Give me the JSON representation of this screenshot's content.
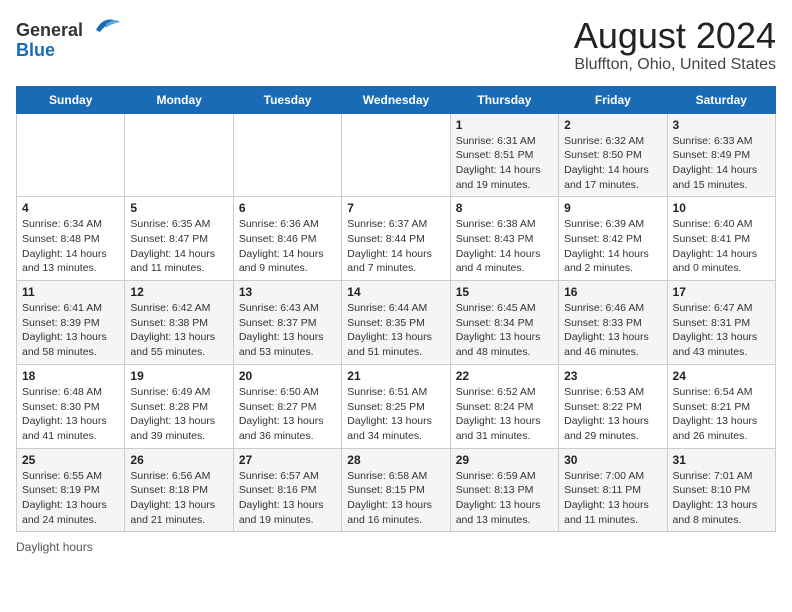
{
  "header": {
    "logo_general": "General",
    "logo_blue": "Blue",
    "title": "August 2024",
    "subtitle": "Bluffton, Ohio, United States"
  },
  "weekdays": [
    "Sunday",
    "Monday",
    "Tuesday",
    "Wednesday",
    "Thursday",
    "Friday",
    "Saturday"
  ],
  "weeks": [
    [
      {
        "day": "",
        "sunrise": "",
        "sunset": "",
        "daylight": ""
      },
      {
        "day": "",
        "sunrise": "",
        "sunset": "",
        "daylight": ""
      },
      {
        "day": "",
        "sunrise": "",
        "sunset": "",
        "daylight": ""
      },
      {
        "day": "",
        "sunrise": "",
        "sunset": "",
        "daylight": ""
      },
      {
        "day": "1",
        "sunrise": "Sunrise: 6:31 AM",
        "sunset": "Sunset: 8:51 PM",
        "daylight": "Daylight: 14 hours and 19 minutes."
      },
      {
        "day": "2",
        "sunrise": "Sunrise: 6:32 AM",
        "sunset": "Sunset: 8:50 PM",
        "daylight": "Daylight: 14 hours and 17 minutes."
      },
      {
        "day": "3",
        "sunrise": "Sunrise: 6:33 AM",
        "sunset": "Sunset: 8:49 PM",
        "daylight": "Daylight: 14 hours and 15 minutes."
      }
    ],
    [
      {
        "day": "4",
        "sunrise": "Sunrise: 6:34 AM",
        "sunset": "Sunset: 8:48 PM",
        "daylight": "Daylight: 14 hours and 13 minutes."
      },
      {
        "day": "5",
        "sunrise": "Sunrise: 6:35 AM",
        "sunset": "Sunset: 8:47 PM",
        "daylight": "Daylight: 14 hours and 11 minutes."
      },
      {
        "day": "6",
        "sunrise": "Sunrise: 6:36 AM",
        "sunset": "Sunset: 8:46 PM",
        "daylight": "Daylight: 14 hours and 9 minutes."
      },
      {
        "day": "7",
        "sunrise": "Sunrise: 6:37 AM",
        "sunset": "Sunset: 8:44 PM",
        "daylight": "Daylight: 14 hours and 7 minutes."
      },
      {
        "day": "8",
        "sunrise": "Sunrise: 6:38 AM",
        "sunset": "Sunset: 8:43 PM",
        "daylight": "Daylight: 14 hours and 4 minutes."
      },
      {
        "day": "9",
        "sunrise": "Sunrise: 6:39 AM",
        "sunset": "Sunset: 8:42 PM",
        "daylight": "Daylight: 14 hours and 2 minutes."
      },
      {
        "day": "10",
        "sunrise": "Sunrise: 6:40 AM",
        "sunset": "Sunset: 8:41 PM",
        "daylight": "Daylight: 14 hours and 0 minutes."
      }
    ],
    [
      {
        "day": "11",
        "sunrise": "Sunrise: 6:41 AM",
        "sunset": "Sunset: 8:39 PM",
        "daylight": "Daylight: 13 hours and 58 minutes."
      },
      {
        "day": "12",
        "sunrise": "Sunrise: 6:42 AM",
        "sunset": "Sunset: 8:38 PM",
        "daylight": "Daylight: 13 hours and 55 minutes."
      },
      {
        "day": "13",
        "sunrise": "Sunrise: 6:43 AM",
        "sunset": "Sunset: 8:37 PM",
        "daylight": "Daylight: 13 hours and 53 minutes."
      },
      {
        "day": "14",
        "sunrise": "Sunrise: 6:44 AM",
        "sunset": "Sunset: 8:35 PM",
        "daylight": "Daylight: 13 hours and 51 minutes."
      },
      {
        "day": "15",
        "sunrise": "Sunrise: 6:45 AM",
        "sunset": "Sunset: 8:34 PM",
        "daylight": "Daylight: 13 hours and 48 minutes."
      },
      {
        "day": "16",
        "sunrise": "Sunrise: 6:46 AM",
        "sunset": "Sunset: 8:33 PM",
        "daylight": "Daylight: 13 hours and 46 minutes."
      },
      {
        "day": "17",
        "sunrise": "Sunrise: 6:47 AM",
        "sunset": "Sunset: 8:31 PM",
        "daylight": "Daylight: 13 hours and 43 minutes."
      }
    ],
    [
      {
        "day": "18",
        "sunrise": "Sunrise: 6:48 AM",
        "sunset": "Sunset: 8:30 PM",
        "daylight": "Daylight: 13 hours and 41 minutes."
      },
      {
        "day": "19",
        "sunrise": "Sunrise: 6:49 AM",
        "sunset": "Sunset: 8:28 PM",
        "daylight": "Daylight: 13 hours and 39 minutes."
      },
      {
        "day": "20",
        "sunrise": "Sunrise: 6:50 AM",
        "sunset": "Sunset: 8:27 PM",
        "daylight": "Daylight: 13 hours and 36 minutes."
      },
      {
        "day": "21",
        "sunrise": "Sunrise: 6:51 AM",
        "sunset": "Sunset: 8:25 PM",
        "daylight": "Daylight: 13 hours and 34 minutes."
      },
      {
        "day": "22",
        "sunrise": "Sunrise: 6:52 AM",
        "sunset": "Sunset: 8:24 PM",
        "daylight": "Daylight: 13 hours and 31 minutes."
      },
      {
        "day": "23",
        "sunrise": "Sunrise: 6:53 AM",
        "sunset": "Sunset: 8:22 PM",
        "daylight": "Daylight: 13 hours and 29 minutes."
      },
      {
        "day": "24",
        "sunrise": "Sunrise: 6:54 AM",
        "sunset": "Sunset: 8:21 PM",
        "daylight": "Daylight: 13 hours and 26 minutes."
      }
    ],
    [
      {
        "day": "25",
        "sunrise": "Sunrise: 6:55 AM",
        "sunset": "Sunset: 8:19 PM",
        "daylight": "Daylight: 13 hours and 24 minutes."
      },
      {
        "day": "26",
        "sunrise": "Sunrise: 6:56 AM",
        "sunset": "Sunset: 8:18 PM",
        "daylight": "Daylight: 13 hours and 21 minutes."
      },
      {
        "day": "27",
        "sunrise": "Sunrise: 6:57 AM",
        "sunset": "Sunset: 8:16 PM",
        "daylight": "Daylight: 13 hours and 19 minutes."
      },
      {
        "day": "28",
        "sunrise": "Sunrise: 6:58 AM",
        "sunset": "Sunset: 8:15 PM",
        "daylight": "Daylight: 13 hours and 16 minutes."
      },
      {
        "day": "29",
        "sunrise": "Sunrise: 6:59 AM",
        "sunset": "Sunset: 8:13 PM",
        "daylight": "Daylight: 13 hours and 13 minutes."
      },
      {
        "day": "30",
        "sunrise": "Sunrise: 7:00 AM",
        "sunset": "Sunset: 8:11 PM",
        "daylight": "Daylight: 13 hours and 11 minutes."
      },
      {
        "day": "31",
        "sunrise": "Sunrise: 7:01 AM",
        "sunset": "Sunset: 8:10 PM",
        "daylight": "Daylight: 13 hours and 8 minutes."
      }
    ]
  ],
  "footer": {
    "daylight_label": "Daylight hours"
  },
  "colors": {
    "header_bg": "#1a6bb5",
    "header_text": "#ffffff",
    "odd_row_bg": "#f5f5f5",
    "even_row_bg": "#ffffff"
  }
}
